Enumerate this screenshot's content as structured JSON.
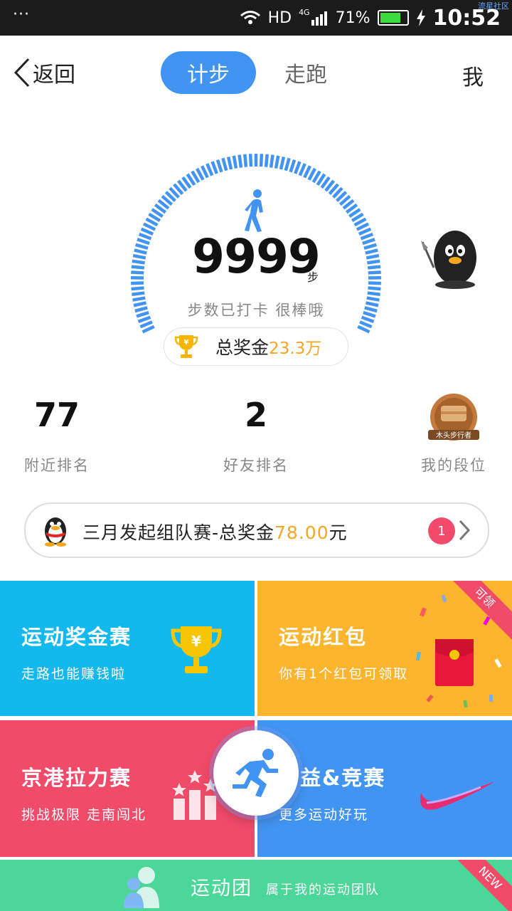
{
  "status_bar": {
    "dots": "···",
    "network": "HD",
    "signal_label": "4G",
    "battery_pct": "71%",
    "battery_level": 0.71,
    "time": "10:52",
    "watermark": "流星社区"
  },
  "header": {
    "back_label": "返回",
    "tabs": [
      "计步",
      "走跑"
    ],
    "active_tab": 0,
    "me_label": "我"
  },
  "gauge": {
    "steps": "9999",
    "unit": "步",
    "message": "步数已打卡  很棒哦",
    "prize_label": "总奖金",
    "prize_amount": "23.3万"
  },
  "ranks": [
    {
      "value": "77",
      "label": "附近排名"
    },
    {
      "value": "2",
      "label": "好友排名"
    },
    {
      "label": "我的段位",
      "badge_text": "木头步行者"
    }
  ],
  "banner": {
    "text": "三月发起组队赛-总奖金",
    "amount": "78.00",
    "currency": "元",
    "count": "1"
  },
  "tiles": [
    {
      "title": "运动奖金赛",
      "subtitle": "走路也能赚钱啦",
      "color": "#13b9ec"
    },
    {
      "title": "运动红包",
      "subtitle": "你有1个红包可领取",
      "color": "#fcb52d",
      "corner": "可领"
    },
    {
      "title": "京港拉力赛",
      "subtitle": "挑战极限 走南闯北",
      "color": "#f14b6a"
    },
    {
      "title": "益&竞赛",
      "subtitle": "更多运动好玩",
      "color": "#4294f2"
    },
    {
      "title": "运动团",
      "subtitle": "属于我的运动团队",
      "color": "#4bd798",
      "corner": "NEW"
    }
  ],
  "colors": {
    "accent": "#4294f2",
    "gold": "#f5a623",
    "pink": "#f14b6a"
  }
}
